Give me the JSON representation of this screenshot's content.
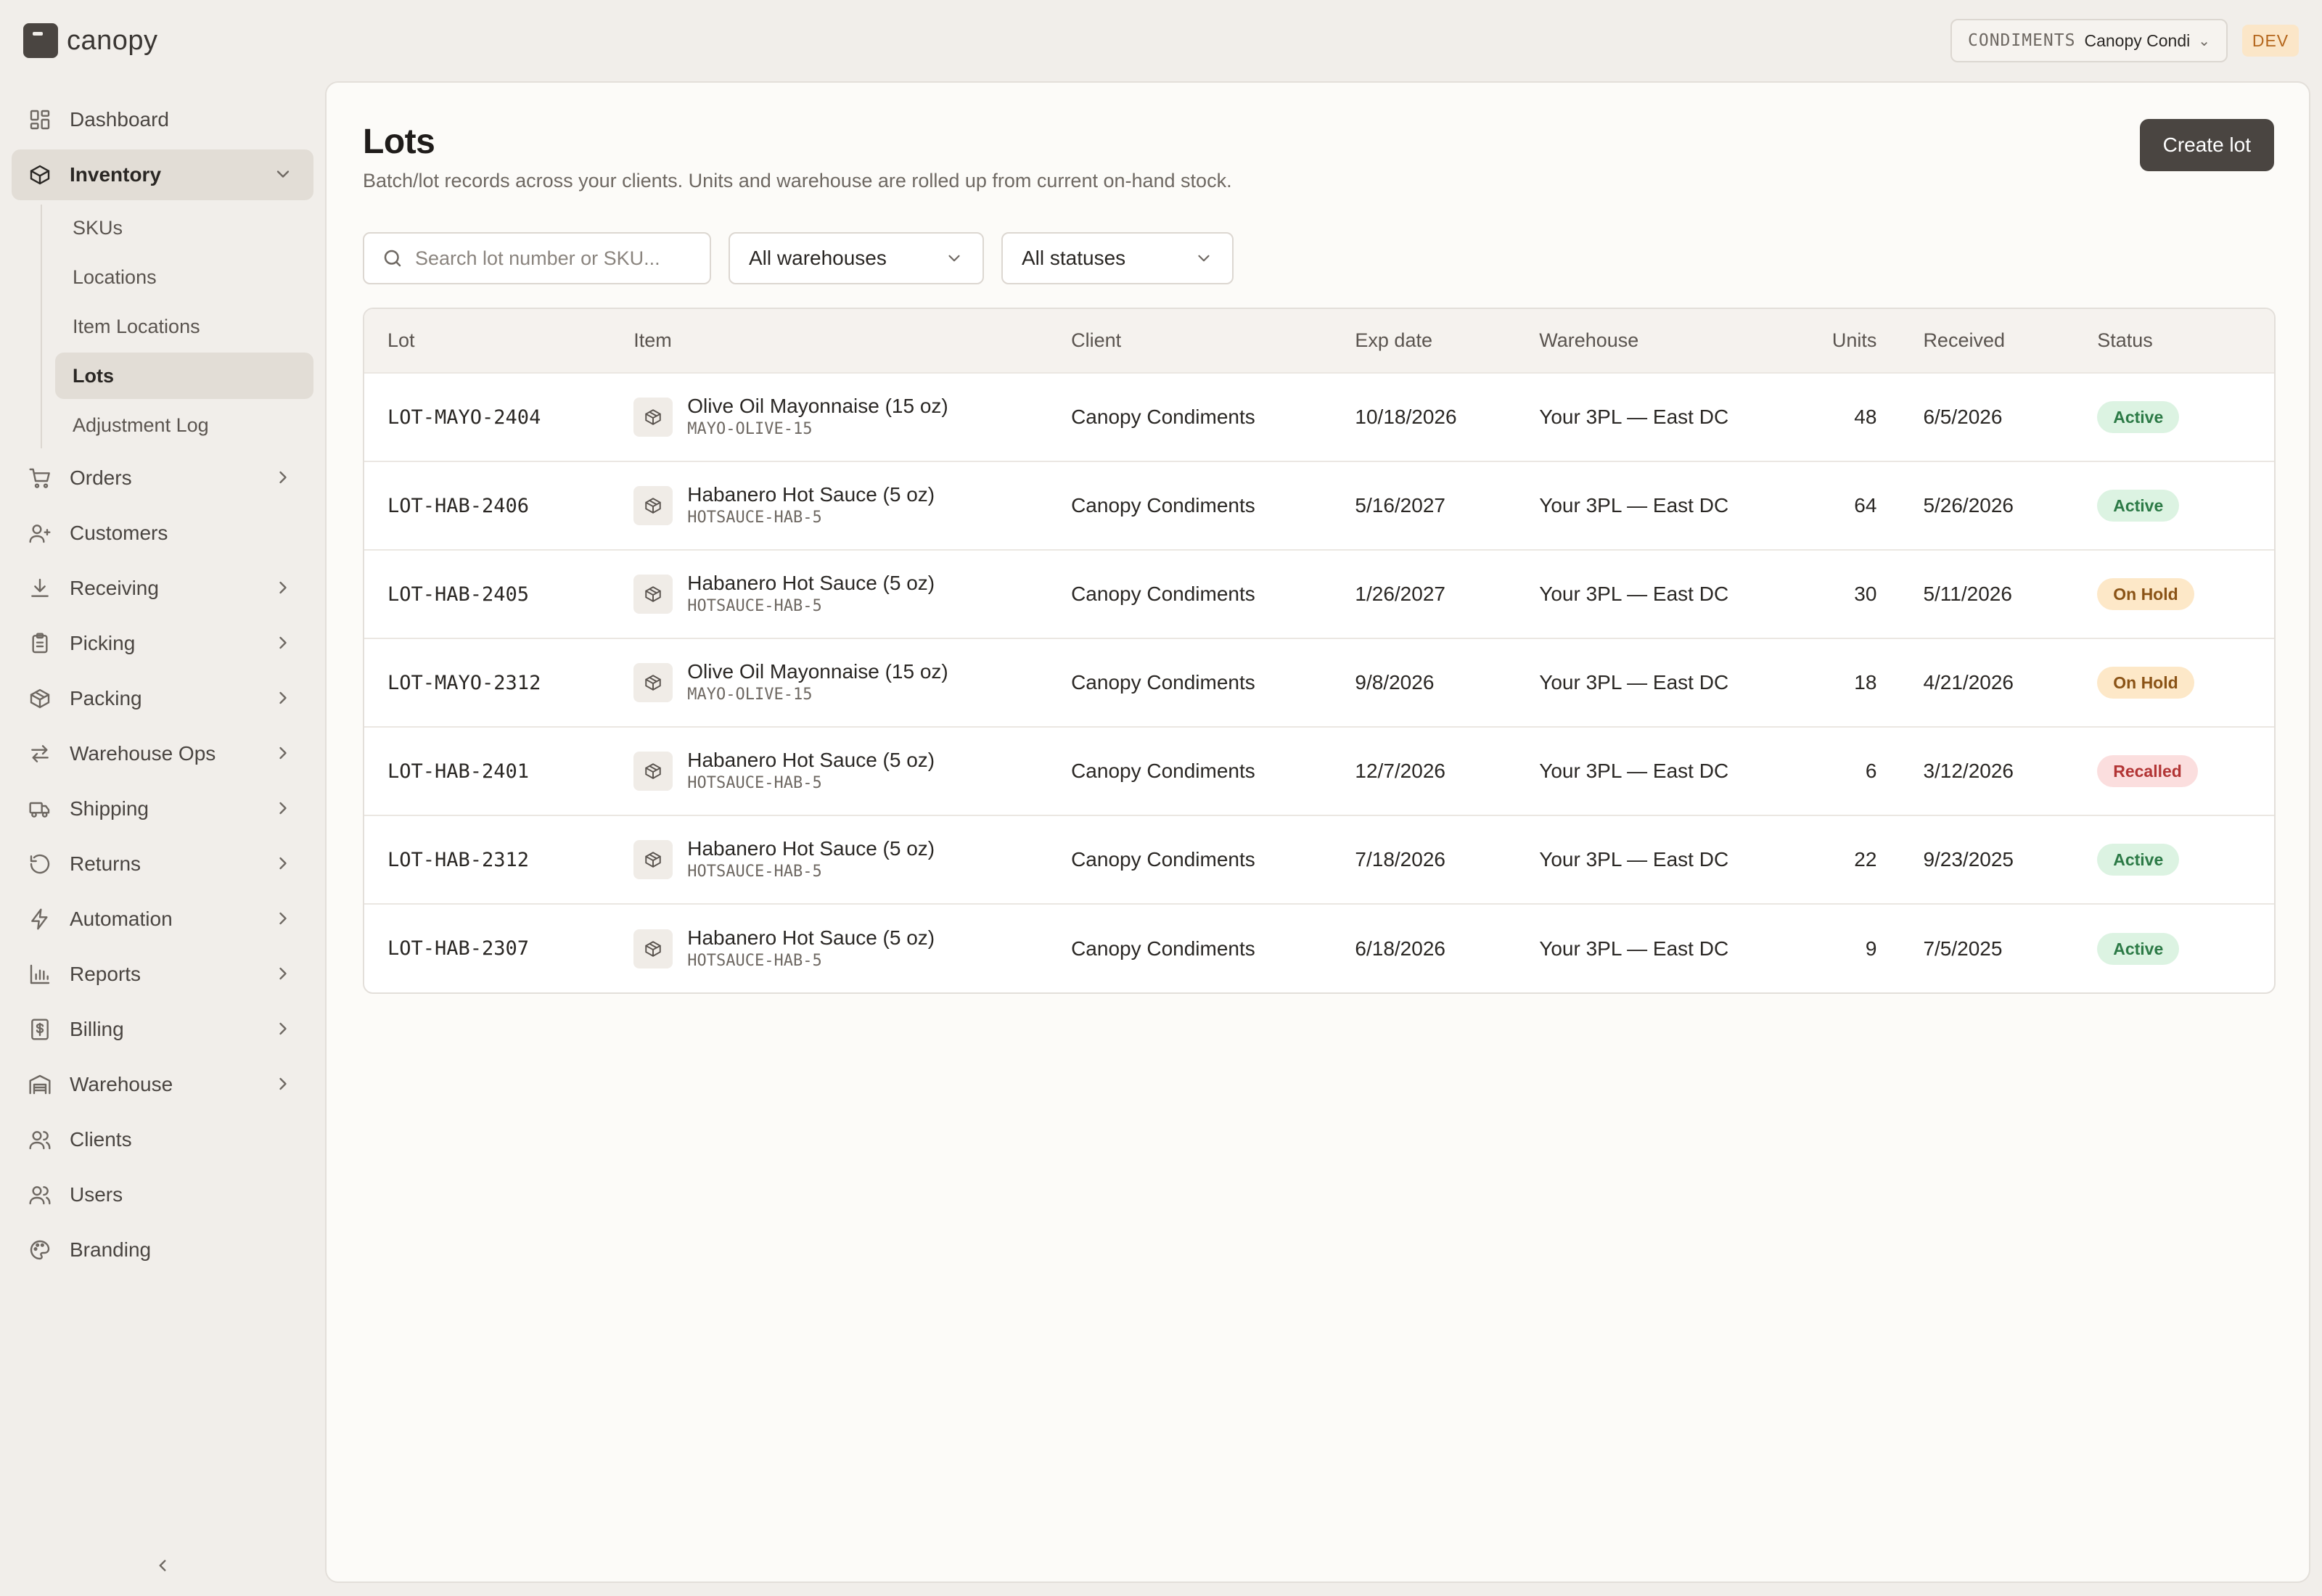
{
  "app": {
    "name": "canopy"
  },
  "header": {
    "client_tag": "CONDIMENTS",
    "client_name": "Canopy Condiments",
    "env_badge": "DEV"
  },
  "sidebar": {
    "items": [
      {
        "label": "Dashboard",
        "icon": "dashboard-icon"
      },
      {
        "label": "Inventory",
        "icon": "box-icon",
        "expanded": true,
        "active": true,
        "children": [
          "SKUs",
          "Locations",
          "Item Locations",
          "Lots",
          "Adjustment Log"
        ],
        "active_child": "Lots"
      },
      {
        "label": "Orders",
        "icon": "cart-icon",
        "has_children": true
      },
      {
        "label": "Customers",
        "icon": "customer-icon"
      },
      {
        "label": "Receiving",
        "icon": "download-icon",
        "has_children": true
      },
      {
        "label": "Picking",
        "icon": "clipboard-icon",
        "has_children": true
      },
      {
        "label": "Packing",
        "icon": "package-icon",
        "has_children": true
      },
      {
        "label": "Warehouse Ops",
        "icon": "transfer-icon",
        "has_children": true
      },
      {
        "label": "Shipping",
        "icon": "truck-icon",
        "has_children": true
      },
      {
        "label": "Returns",
        "icon": "return-icon",
        "has_children": true
      },
      {
        "label": "Automation",
        "icon": "bolt-icon",
        "has_children": true
      },
      {
        "label": "Reports",
        "icon": "chart-icon",
        "has_children": true
      },
      {
        "label": "Billing",
        "icon": "billing-icon",
        "has_children": true
      },
      {
        "label": "Warehouse",
        "icon": "warehouse-icon",
        "has_children": true
      },
      {
        "label": "Clients",
        "icon": "clients-icon"
      },
      {
        "label": "Users",
        "icon": "users-icon"
      },
      {
        "label": "Branding",
        "icon": "palette-icon"
      }
    ]
  },
  "page": {
    "title": "Lots",
    "subtitle": "Batch/lot records across your clients. Units and warehouse are rolled up from current on-hand stock.",
    "create_label": "Create lot",
    "search_placeholder": "Search lot number or SKU...",
    "warehouse_filter": "All warehouses",
    "status_filter": "All statuses"
  },
  "table": {
    "columns": [
      "Lot",
      "Item",
      "Client",
      "Exp date",
      "Warehouse",
      "Units",
      "Received",
      "Status"
    ],
    "rows": [
      {
        "lot": "LOT-MAYO-2404",
        "item": "Olive Oil Mayonnaise (15 oz)",
        "sku": "MAYO-OLIVE-15",
        "client": "Canopy Condiments",
        "exp": "10/18/2026",
        "warehouse": "Your 3PL — East DC",
        "units": "48",
        "received": "6/5/2026",
        "status": "Active"
      },
      {
        "lot": "LOT-HAB-2406",
        "item": "Habanero Hot Sauce (5 oz)",
        "sku": "HOTSAUCE-HAB-5",
        "client": "Canopy Condiments",
        "exp": "5/16/2027",
        "warehouse": "Your 3PL — East DC",
        "units": "64",
        "received": "5/26/2026",
        "status": "Active"
      },
      {
        "lot": "LOT-HAB-2405",
        "item": "Habanero Hot Sauce (5 oz)",
        "sku": "HOTSAUCE-HAB-5",
        "client": "Canopy Condiments",
        "exp": "1/26/2027",
        "warehouse": "Your 3PL — East DC",
        "units": "30",
        "received": "5/11/2026",
        "status": "On Hold"
      },
      {
        "lot": "LOT-MAYO-2312",
        "item": "Olive Oil Mayonnaise (15 oz)",
        "sku": "MAYO-OLIVE-15",
        "client": "Canopy Condiments",
        "exp": "9/8/2026",
        "warehouse": "Your 3PL — East DC",
        "units": "18",
        "received": "4/21/2026",
        "status": "On Hold"
      },
      {
        "lot": "LOT-HAB-2401",
        "item": "Habanero Hot Sauce (5 oz)",
        "sku": "HOTSAUCE-HAB-5",
        "client": "Canopy Condiments",
        "exp": "12/7/2026",
        "warehouse": "Your 3PL — East DC",
        "units": "6",
        "received": "3/12/2026",
        "status": "Recalled"
      },
      {
        "lot": "LOT-HAB-2312",
        "item": "Habanero Hot Sauce (5 oz)",
        "sku": "HOTSAUCE-HAB-5",
        "client": "Canopy Condiments",
        "exp": "7/18/2026",
        "warehouse": "Your 3PL — East DC",
        "units": "22",
        "received": "9/23/2025",
        "status": "Active"
      },
      {
        "lot": "LOT-HAB-2307",
        "item": "Habanero Hot Sauce (5 oz)",
        "sku": "HOTSAUCE-HAB-5",
        "client": "Canopy Condiments",
        "exp": "6/18/2026",
        "warehouse": "Your 3PL — East DC",
        "units": "9",
        "received": "7/5/2025",
        "status": "Active"
      }
    ]
  },
  "colors": {
    "accent": "#4a4541",
    "active_badge": "#dcf3e2",
    "hold_badge": "#fde8c8",
    "recalled_badge": "#fbdede"
  }
}
